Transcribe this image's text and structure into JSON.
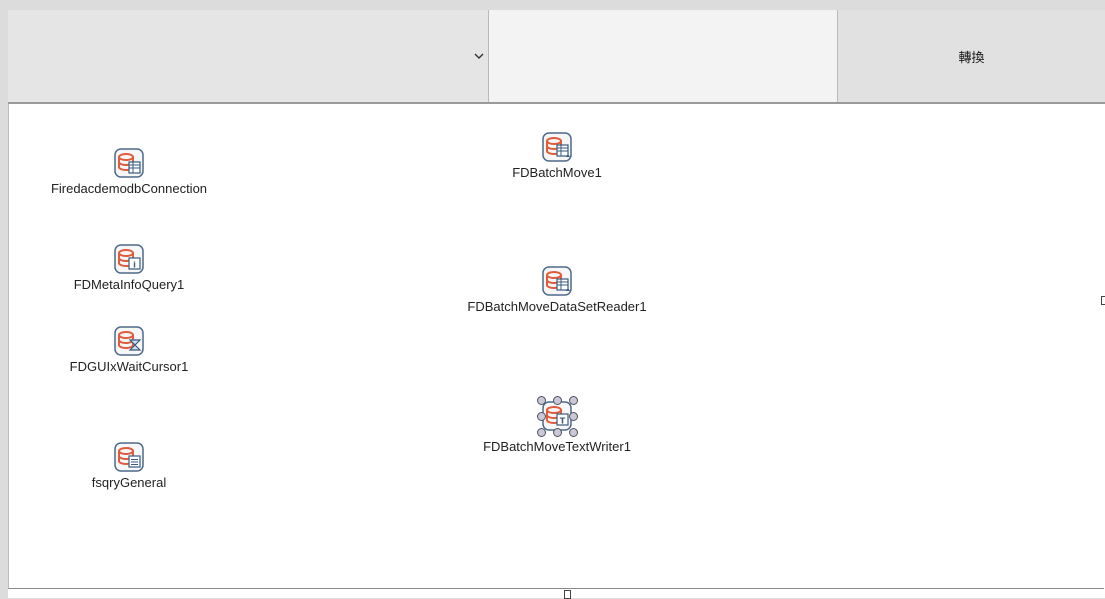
{
  "toolbar": {
    "combo_value": "",
    "edit_value": "",
    "convert_label": "轉換"
  },
  "components": {
    "firedac_connection": "FiredacdemodbConnection",
    "meta_info_query": "FDMetaInfoQuery1",
    "gui_wait_cursor": "FDGUIxWaitCursor1",
    "fsqry_general": "fsqryGeneral",
    "batch_move": "FDBatchMove1",
    "batch_move_reader": "FDBatchMoveDataSetReader1",
    "batch_move_writer": "FDBatchMoveTextWriter1"
  },
  "colors": {
    "db_accent": "#e05a3c",
    "icon_border": "#4d6a8a"
  }
}
